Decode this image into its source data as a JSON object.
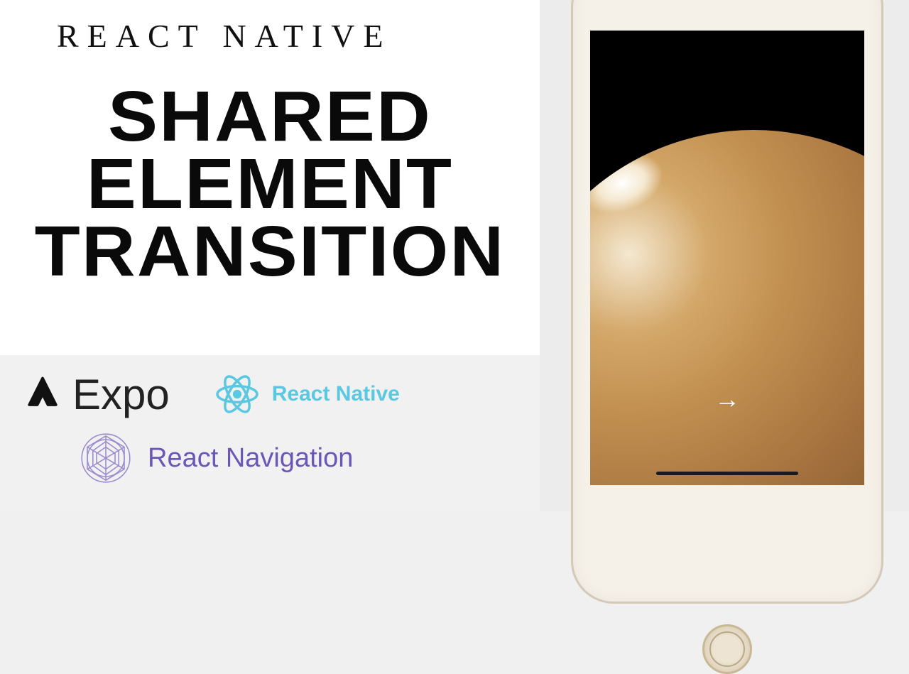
{
  "eyebrow": "REACT NATIVE",
  "headline_line1": "SHARED",
  "headline_line2": "ELEMENT",
  "headline_line3": "TRANSITION",
  "logos": {
    "expo": "Expo",
    "react_native": "React Native",
    "react_navigation": "React Navigation"
  },
  "colors": {
    "react_blue": "#5ac8e0",
    "nav_purple": "#6b57b8",
    "text_dark": "#0a0a0a"
  }
}
